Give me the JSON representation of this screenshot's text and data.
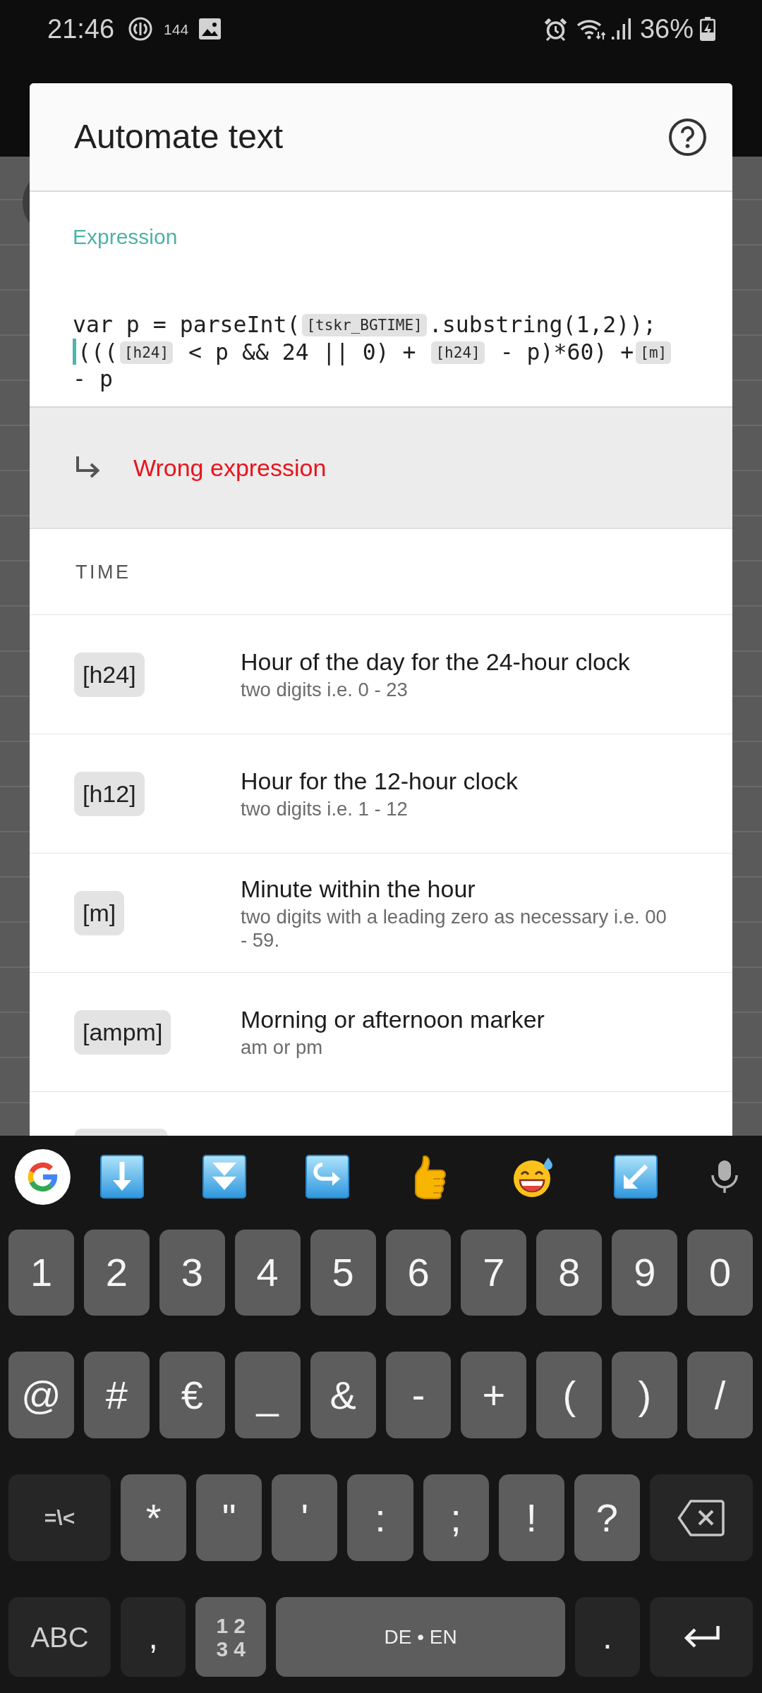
{
  "status_bar": {
    "time": "21:46",
    "indicator": "144",
    "battery": "36%"
  },
  "dialog": {
    "title": "Automate text",
    "expression": {
      "label": "Expression",
      "lines": [
        [
          {
            "kind": "text",
            "text": "var p = parseInt("
          },
          {
            "kind": "token",
            "text": "[tskr_BGTIME]"
          },
          {
            "kind": "text",
            "text": ".substring(1,2));"
          }
        ],
        [
          {
            "kind": "cursor"
          },
          {
            "kind": "text",
            "text": "((("
          },
          {
            "kind": "token",
            "text": "[h24]"
          },
          {
            "kind": "text",
            "text": " < p && 24 || 0) + "
          },
          {
            "kind": "token",
            "text": "[h24]"
          },
          {
            "kind": "text",
            "text": " - p)*60) +"
          },
          {
            "kind": "token",
            "text": "[m]"
          }
        ],
        [
          {
            "kind": "text",
            "text": "- p"
          }
        ]
      ]
    },
    "result": {
      "message": "Wrong expression"
    },
    "section": {
      "title": "TIME"
    },
    "variables": [
      {
        "token": "[h24]",
        "title": "Hour of the day for the 24-hour clock",
        "description": "two digits i.e. 0 - 23"
      },
      {
        "token": "[h12]",
        "title": "Hour for the 12-hour clock",
        "description": "two digits i.e. 1 - 12"
      },
      {
        "token": "[m]",
        "title": "Minute within the hour",
        "description": "two digits with a leading zero as necessary i.e. 00 - 59."
      },
      {
        "token": "[ampm]",
        "title": "Morning or afternoon marker",
        "description": "am or pm"
      }
    ]
  },
  "keyboard": {
    "rows": [
      {
        "keys": [
          {
            "kind": "char",
            "label": "1"
          },
          {
            "kind": "char",
            "label": "2"
          },
          {
            "kind": "char",
            "label": "3"
          },
          {
            "kind": "char",
            "label": "4"
          },
          {
            "kind": "char",
            "label": "5"
          },
          {
            "kind": "char",
            "label": "6"
          },
          {
            "kind": "char",
            "label": "7"
          },
          {
            "kind": "char",
            "label": "8"
          },
          {
            "kind": "char",
            "label": "9"
          },
          {
            "kind": "char",
            "label": "0"
          }
        ]
      },
      {
        "keys": [
          {
            "kind": "char",
            "label": "@"
          },
          {
            "kind": "char",
            "label": "#"
          },
          {
            "kind": "char",
            "label": "€"
          },
          {
            "kind": "char",
            "label": "_"
          },
          {
            "kind": "char",
            "label": "&"
          },
          {
            "kind": "char",
            "label": "-"
          },
          {
            "kind": "char",
            "label": "+"
          },
          {
            "kind": "char",
            "label": "("
          },
          {
            "kind": "char",
            "label": ")"
          },
          {
            "kind": "char",
            "label": "/"
          }
        ]
      },
      {
        "keys": [
          {
            "kind": "symbols",
            "label": "=\\<"
          },
          {
            "kind": "char",
            "label": "*"
          },
          {
            "kind": "char",
            "label": "\""
          },
          {
            "kind": "char",
            "label": "'"
          },
          {
            "kind": "char",
            "label": ":"
          },
          {
            "kind": "char",
            "label": ";"
          },
          {
            "kind": "char",
            "label": "!"
          },
          {
            "kind": "char",
            "label": "?"
          },
          {
            "kind": "backspace"
          }
        ]
      },
      {
        "keys": [
          {
            "kind": "letters",
            "label": "ABC"
          },
          {
            "kind": "punct",
            "label": ","
          },
          {
            "kind": "numbers",
            "lines": [
              "12",
              "34"
            ]
          },
          {
            "kind": "space",
            "label": "DE • EN"
          },
          {
            "kind": "punct",
            "label": "."
          },
          {
            "kind": "enter"
          }
        ]
      }
    ]
  }
}
